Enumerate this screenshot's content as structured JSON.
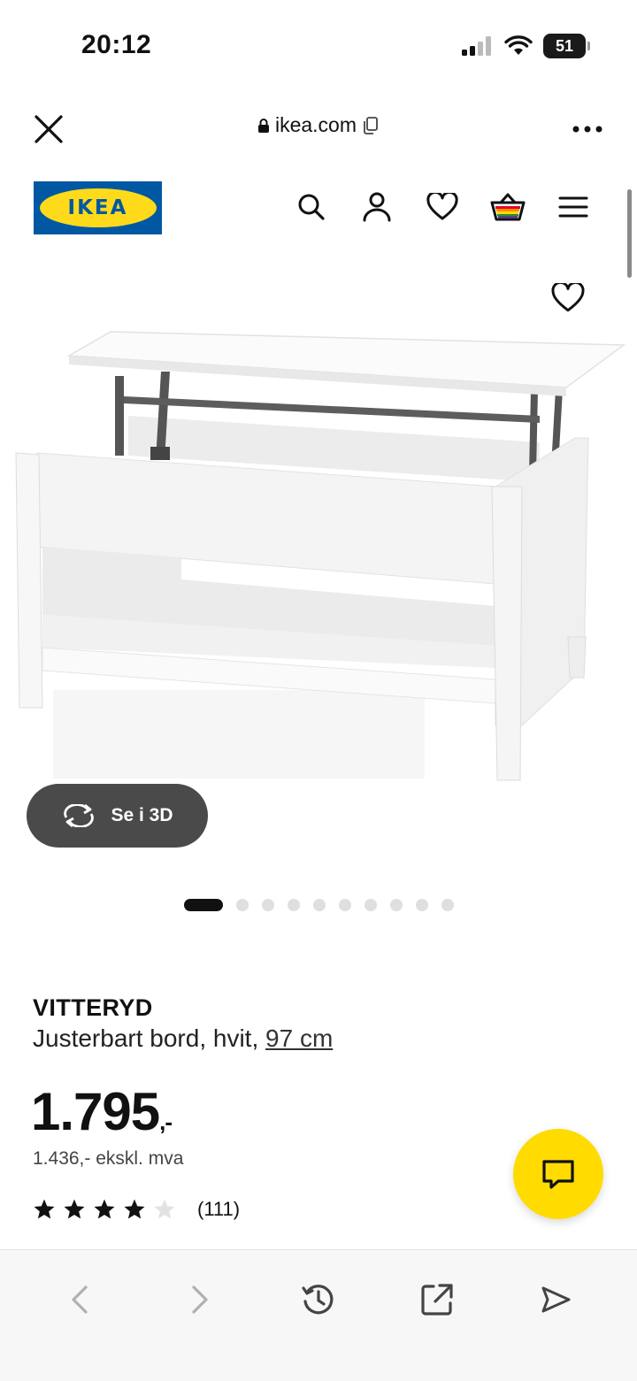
{
  "status_bar": {
    "time": "20:12",
    "battery": "51"
  },
  "browser": {
    "url": "ikea.com"
  },
  "site": {
    "logo_text": "IKEA"
  },
  "product": {
    "name": "VITTERYD",
    "description": "Justerbart bord, hvit,",
    "size": "97 cm",
    "price": "1.795",
    "price_suffix": ",-",
    "price_ex_vat": "1.436,- ekskl. mva",
    "rating": 4,
    "rating_max": 5,
    "rating_count": "(111)"
  },
  "gallery": {
    "view_3d_label": "Se i 3D",
    "total_images": 11,
    "active_index": 0
  },
  "colors": {
    "ikea_blue": "#0058a3",
    "ikea_yellow": "#ffda1a",
    "chat_yellow": "#ffdb00"
  },
  "icons": {
    "header": [
      "search-icon",
      "user-icon",
      "heart-icon",
      "basket-icon",
      "menu-icon"
    ],
    "toolbar": [
      "back-icon",
      "forward-icon",
      "history-icon",
      "share-icon",
      "send-icon"
    ]
  }
}
